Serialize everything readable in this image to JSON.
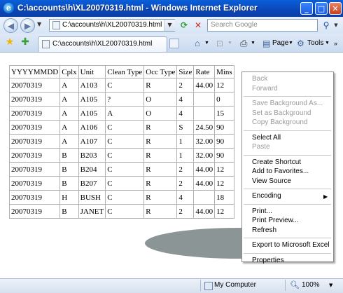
{
  "window": {
    "title": "C:\\accounts\\h\\XL20070319.html - Windows Internet Explorer",
    "controls": {
      "minimize": "_",
      "maximize": "□",
      "close": "✕"
    }
  },
  "navigation": {
    "address": "C:\\accounts\\h\\XL20070319.html",
    "search_placeholder": "Search Google"
  },
  "tab": {
    "label": "C:\\accounts\\h\\XL20070319.html"
  },
  "toolbar": {
    "page_label": "Page",
    "tools_label": "Tools"
  },
  "table": {
    "headers": [
      "YYYYMMDD",
      "Cplx",
      "Unit",
      "Clean Type",
      "Occ Type",
      "Size",
      "Rate",
      "Mins"
    ],
    "rows": [
      [
        "20070319",
        "A",
        "A103",
        "C",
        "R",
        "2",
        "44.00",
        "12"
      ],
      [
        "20070319",
        "A",
        "A105",
        "?",
        "O",
        "4",
        "",
        "0"
      ],
      [
        "20070319",
        "A",
        "A105",
        "A",
        "O",
        "4",
        "",
        "15"
      ],
      [
        "20070319",
        "A",
        "A106",
        "C",
        "R",
        "S",
        "24.50",
        "90"
      ],
      [
        "20070319",
        "A",
        "A107",
        "C",
        "R",
        "1",
        "32.00",
        "90"
      ],
      [
        "20070319",
        "B",
        "B203",
        "C",
        "R",
        "1",
        "32.00",
        "90"
      ],
      [
        "20070319",
        "B",
        "B204",
        "C",
        "R",
        "2",
        "44.00",
        "12"
      ],
      [
        "20070319",
        "B",
        "B207",
        "C",
        "R",
        "2",
        "44.00",
        "12"
      ],
      [
        "20070319",
        "H",
        "BUSH",
        "C",
        "R",
        "4",
        "",
        "18"
      ],
      [
        "20070319",
        "B",
        "JANET",
        "C",
        "R",
        "2",
        "44.00",
        "12"
      ]
    ]
  },
  "context_menu": {
    "groups": [
      [
        {
          "label": "Back",
          "enabled": false
        },
        {
          "label": "Forward",
          "enabled": false
        }
      ],
      [
        {
          "label": "Save Background As...",
          "enabled": false
        },
        {
          "label": "Set as Background",
          "enabled": false
        },
        {
          "label": "Copy Background",
          "enabled": false
        }
      ],
      [
        {
          "label": "Select All",
          "enabled": true
        },
        {
          "label": "Paste",
          "enabled": false
        }
      ],
      [
        {
          "label": "Create Shortcut",
          "enabled": true
        },
        {
          "label": "Add to Favorites...",
          "enabled": true
        },
        {
          "label": "View Source",
          "enabled": true
        }
      ],
      [
        {
          "label": "Encoding",
          "enabled": true,
          "submenu": true
        }
      ],
      [
        {
          "label": "Print...",
          "enabled": true
        },
        {
          "label": "Print Preview...",
          "enabled": true
        },
        {
          "label": "Refresh",
          "enabled": true
        }
      ],
      [
        {
          "label": "Export to Microsoft Excel",
          "enabled": true
        }
      ],
      [
        {
          "label": "Properties",
          "enabled": true
        }
      ]
    ]
  },
  "statusbar": {
    "zone": "My Computer",
    "zoom": "100%"
  }
}
